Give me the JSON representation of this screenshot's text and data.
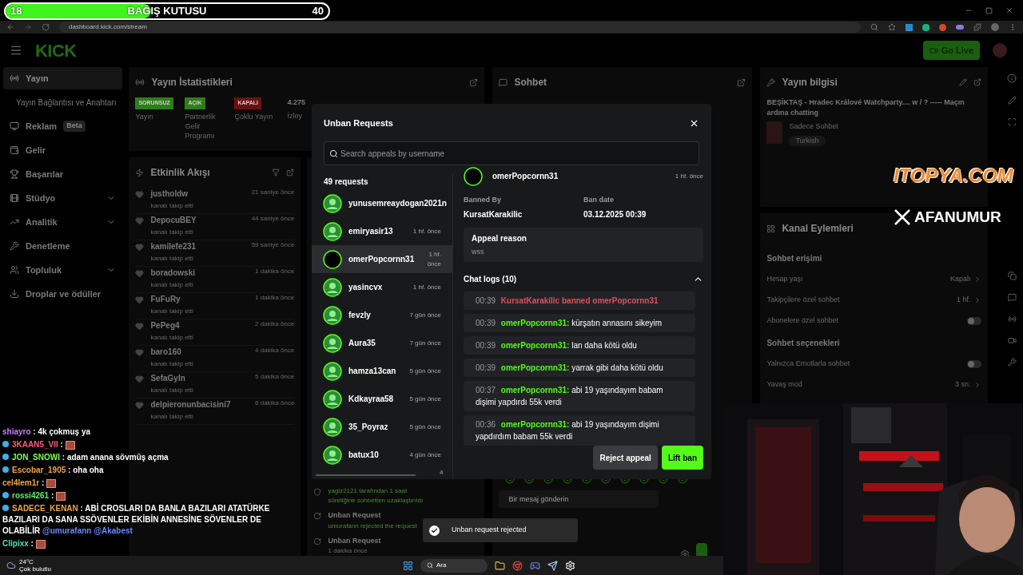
{
  "donation_bar": {
    "current": "18",
    "title": "BAĞIŞ KUTUSU",
    "goal": "40",
    "level": 0.45
  },
  "browser": {
    "url": "dashboard.kick.com/stream"
  },
  "header": {
    "logo": "KICK",
    "go_live": "Go Live"
  },
  "sidebar": {
    "items": [
      {
        "label": "Yayın",
        "selected": true
      },
      {
        "label": "Yayın Bağlantısı ve Anahtarı",
        "selected": false,
        "kind": "sub"
      },
      {
        "label": "Reklam",
        "selected": false,
        "badge": "Beta"
      },
      {
        "label": "Gelir",
        "selected": false
      },
      {
        "label": "Başarılar",
        "selected": false
      },
      {
        "label": "Stüdyo",
        "selected": false,
        "expandable": true
      },
      {
        "label": "Analitik",
        "selected": false,
        "expandable": true
      },
      {
        "label": "Denetleme",
        "selected": false
      },
      {
        "label": "Topluluk",
        "selected": false,
        "expandable": true
      },
      {
        "label": "Droplar ve ödüller",
        "selected": false
      }
    ]
  },
  "stats": {
    "title": "Yayın İstatistikleri",
    "items": [
      {
        "badge": "SORUNSUZ",
        "label": "Yayın",
        "color": "#2f7d1a"
      },
      {
        "badge": "AÇIK",
        "label": "Partnerlik Gelir Programı",
        "color": "#2f7d1a"
      },
      {
        "badge": "KAPALI",
        "label": "Çoklu Yayın",
        "color": "#6b1010"
      }
    ],
    "viewers": "4.275",
    "viewers_label": "İzley"
  },
  "activity": {
    "title": "Etkinlik Akışı",
    "items": [
      {
        "name": "justholdw",
        "time": "21 saniye önce",
        "action": "kanalı takip etti"
      },
      {
        "name": "DepocuBEY",
        "time": "44 saniye önce",
        "action": "kanalı takip etti"
      },
      {
        "name": "kamilefe231",
        "time": "59 saniye önce",
        "action": "kanalı takip etti"
      },
      {
        "name": "boradowski",
        "time": "1 dakika önce",
        "action": "kanalı takip etti"
      },
      {
        "name": "FuFuRy",
        "time": "1 dakika önce",
        "action": "kanalı takip etti"
      },
      {
        "name": "PePeg4",
        "time": "2 dakika önce",
        "action": "kanalı takip etti"
      },
      {
        "name": "baro160",
        "time": "4 dakika önce",
        "action": "kanalı takip etti"
      },
      {
        "name": "SefaGyln",
        "time": "5 dakika önce",
        "action": "kanalı takip etti"
      },
      {
        "name": "delpieronunbacisini7",
        "time": "6 dakika önce",
        "action": "kanalı takip etti"
      }
    ]
  },
  "mod_log": {
    "items": [
      {
        "kind": "timeout",
        "text": "yagiz2121 tarafından 1 saat süreliğine sohbetten uzaklaştırıldı"
      },
      {
        "kind": "unban",
        "title": "Unban Request",
        "text": "umurafann rejected the request"
      },
      {
        "kind": "unban",
        "title": "Unban Request",
        "time": "1 dakika önce"
      }
    ]
  },
  "chat_panel": {
    "title": "Sohbet",
    "placeholder": "Bir mesaj gönderin"
  },
  "stream_info": {
    "title": "Yayın bilgisi",
    "stream_title": "BEŞİKTAŞ - Hradec Králové Watchparty.... w / ? ----- Maçın ardına chatting",
    "category": "Sadece Sohbet",
    "tag": "Turkish"
  },
  "channel_actions": {
    "title": "Kanal Eylemleri",
    "items": [
      {
        "kind": "section",
        "label": "Sohbet erişimi"
      },
      {
        "kind": "link",
        "label": "Hesap yaşı",
        "value": "Kapalı"
      },
      {
        "kind": "link",
        "label": "Takipçilere özel sohbet",
        "value": "1 hf."
      },
      {
        "kind": "toggle",
        "label": "Abonelere özel sohbet",
        "on": false
      },
      {
        "kind": "section",
        "label": "Sohbet seçenekleri"
      },
      {
        "kind": "toggle",
        "label": "Yalnızca Emotlarla sohbet",
        "on": false
      },
      {
        "kind": "link",
        "label": "Yavaş mod",
        "value": "3 sn."
      }
    ]
  },
  "modal": {
    "title": "Unban Requests",
    "search_placeholder": "Search appeals by username",
    "count": "49 requests",
    "page_marker": "4",
    "requests": [
      {
        "name": "yunusemreaydogan2021n",
        "selected": false
      },
      {
        "name": "emiryasir13",
        "time": "1 hf. önce",
        "selected": false
      },
      {
        "name": "omerPopcornn31",
        "time": "1 hf. önce",
        "selected": true
      },
      {
        "name": "yasincvx",
        "time": "1 hf. önce",
        "selected": false
      },
      {
        "name": "fevzly",
        "time": "7 gün önce",
        "selected": false
      },
      {
        "name": "Aura35",
        "time": "7 gün önce",
        "selected": false
      },
      {
        "name": "hamza13can",
        "time": "5 gün önce",
        "selected": false
      },
      {
        "name": "Kdkayraa58",
        "time": "5 gün önce",
        "selected": false
      },
      {
        "name": "35_Poyraz",
        "time": "5 gün önce",
        "selected": false
      },
      {
        "name": "batux10",
        "time": "4 gün önce",
        "selected": false
      }
    ],
    "detail": {
      "name": "omerPopcornn31",
      "time": "1 hf. önce",
      "banned_by_label": "Banned By",
      "banned_by": "KursatKarakilic",
      "ban_date_label": "Ban date",
      "ban_date": "03.12.2025 00:39",
      "appeal_label": "Appeal reason",
      "appeal": "wss",
      "logs_title": "Chat logs (10)",
      "logs_expanded": true,
      "logs": [
        {
          "kind": "ban",
          "time": "00:39",
          "text": "KursatKarakilic banned omerPopcornn31"
        },
        {
          "kind": "message",
          "time": "00:39",
          "user": "omerPopcornn31:",
          "text": "kürşatın annasını sikeyim"
        },
        {
          "kind": "message",
          "time": "00:39",
          "user": "omerPopcornn31:",
          "text": "lan daha kötü oldu"
        },
        {
          "kind": "message",
          "time": "00:39",
          "user": "omerPopcornn31:",
          "text": "yarrak gibi daha kötü oldu"
        },
        {
          "kind": "message",
          "time": "00:37",
          "user": "omerPopcornn31:",
          "text": "abi 19 yaşındayım babam dişimi yapdırdı 55k verdi"
        },
        {
          "kind": "message",
          "time": "00:36",
          "user": "omerPopcornn31:",
          "text": "abi 19 yaşındayım dişimi yapdırdım babam 55k verdi"
        }
      ]
    },
    "buttons": [
      {
        "kind": "secondary",
        "label": "Reject appeal"
      },
      {
        "kind": "primary",
        "label": "Lift ban"
      }
    ]
  },
  "toast": {
    "text": "Unban request rejected"
  },
  "overlay_chat": [
    {
      "name": "shiayro",
      "sep": ":",
      "color": "#c77dff",
      "badged": false,
      "kind": "text",
      "text": "4k çokmuş ya"
    },
    {
      "name": "3KAAN5_VII",
      "sep": ":",
      "color": "#ff5c7a",
      "badged": true,
      "kind": "emote"
    },
    {
      "name": "JON_SNOWI",
      "sep": ":",
      "color": "#7cff4f",
      "badged": true,
      "kind": "text",
      "text": "adam anana sövmüş açma"
    },
    {
      "name": "Escobar_1905",
      "sep": ":",
      "color": "#f0a640",
      "badged": true,
      "kind": "text",
      "text": "oha oha"
    },
    {
      "name": "cel4lem1r",
      "sep": ":",
      "color": "#f0a640",
      "badged": false,
      "kind": "emote"
    },
    {
      "name": "rossi4261",
      "sep": ":",
      "color": "#5cf06a",
      "badged": true,
      "kind": "emote"
    },
    {
      "name": "SADECE_KENAN",
      "sep": ":",
      "color": "#f0a640",
      "badged": true,
      "kind": "text",
      "text": "ABİ CROSLARI DA BANLA BAZILARI ATATÜRKE BAZILARI DA SANA SSÖVENLER EKİBİN ANNESİNE SÖVENLER DE OLABİLİR",
      "mentions": [
        "@umurafann",
        "@Akabest"
      ]
    },
    {
      "name": "Clipixx",
      "sep": ":",
      "color": "#4fe0b0",
      "badged": false,
      "kind": "emote"
    }
  ],
  "sponsor": {
    "text": "ITOPYA.COM"
  },
  "social": {
    "handle": "AFANUMUR"
  },
  "taskbar": {
    "weather_temp": "24°C",
    "weather_text": "Çok bulutlu",
    "search": "Ara"
  }
}
